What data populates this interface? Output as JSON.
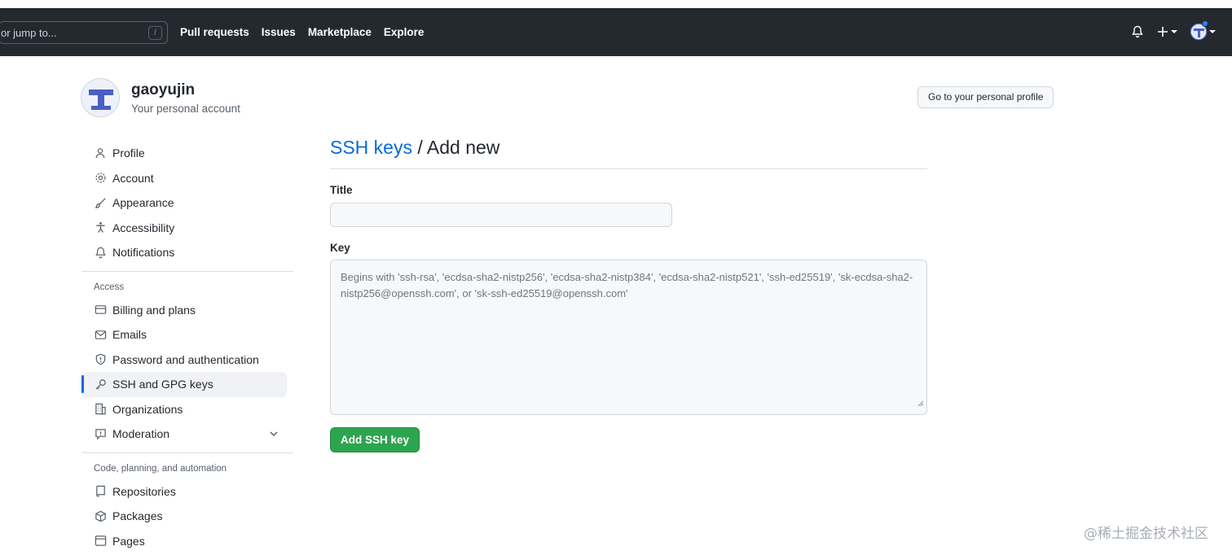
{
  "header": {
    "search_placeholder": "or jump to...",
    "search_shortcut": "/",
    "nav": [
      "Pull requests",
      "Issues",
      "Marketplace",
      "Explore"
    ],
    "icons": [
      "bell-icon",
      "plus-icon",
      "avatar"
    ]
  },
  "profile": {
    "name": "gaoyujin",
    "subtitle": "Your personal account",
    "button_label": "Go to your personal profile"
  },
  "sidebar": {
    "group1": [
      {
        "label": "Profile",
        "icon": "person-icon"
      },
      {
        "label": "Account",
        "icon": "gear-icon"
      },
      {
        "label": "Appearance",
        "icon": "paintbrush-icon"
      },
      {
        "label": "Accessibility",
        "icon": "accessibility-icon"
      },
      {
        "label": "Notifications",
        "icon": "bell-icon"
      }
    ],
    "access_heading": "Access",
    "group2": [
      {
        "label": "Billing and plans",
        "icon": "credit-card-icon"
      },
      {
        "label": "Emails",
        "icon": "mail-icon"
      },
      {
        "label": "Password and authentication",
        "icon": "shield-icon"
      },
      {
        "label": "SSH and GPG keys",
        "icon": "key-icon",
        "active": true
      },
      {
        "label": "Organizations",
        "icon": "organization-icon"
      },
      {
        "label": "Moderation",
        "icon": "report-icon"
      }
    ],
    "code_heading": "Code, planning, and automation",
    "group3": [
      {
        "label": "Repositories",
        "icon": "repo-icon"
      },
      {
        "label": "Packages",
        "icon": "package-icon"
      },
      {
        "label": "Pages",
        "icon": "browser-icon"
      }
    ]
  },
  "main": {
    "title_link": "SSH keys",
    "title_rest": " / Add new",
    "title_label": "Title",
    "title_value": "",
    "key_label": "Key",
    "key_placeholder": "Begins with 'ssh-rsa', 'ecdsa-sha2-nistp256', 'ecdsa-sha2-nistp384', 'ecdsa-sha2-nistp521', 'ssh-ed25519', 'sk-ecdsa-sha2-nistp256@openssh.com', or 'sk-ssh-ed25519@openssh.com'",
    "submit_label": "Add SSH key"
  },
  "watermark": "@稀土掘金技术社区",
  "colors": {
    "header_bg": "#24292f",
    "link": "#0969da",
    "primary_button": "#2da44e",
    "active_indicator": "#0969da"
  }
}
